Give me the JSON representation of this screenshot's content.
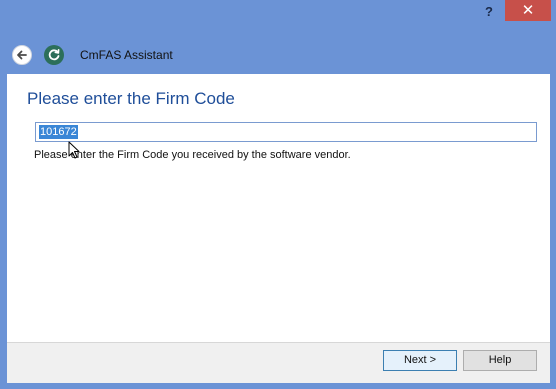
{
  "window": {
    "help_symbol": "?",
    "close_symbol": "✕"
  },
  "header": {
    "title": "CmFAS Assistant",
    "back_icon": "back-arrow-icon",
    "app_icon": "refresh-cycle-icon"
  },
  "main": {
    "heading": "Please enter the Firm Code",
    "firm_code_value": "101672",
    "hint": "Please enter the Firm Code you received by the software vendor."
  },
  "footer": {
    "next_label": "Next >",
    "help_label": "Help"
  },
  "colors": {
    "frame": "#6b93d6",
    "heading": "#1f4e99",
    "close": "#c7504a",
    "selection": "#3a86d6"
  }
}
